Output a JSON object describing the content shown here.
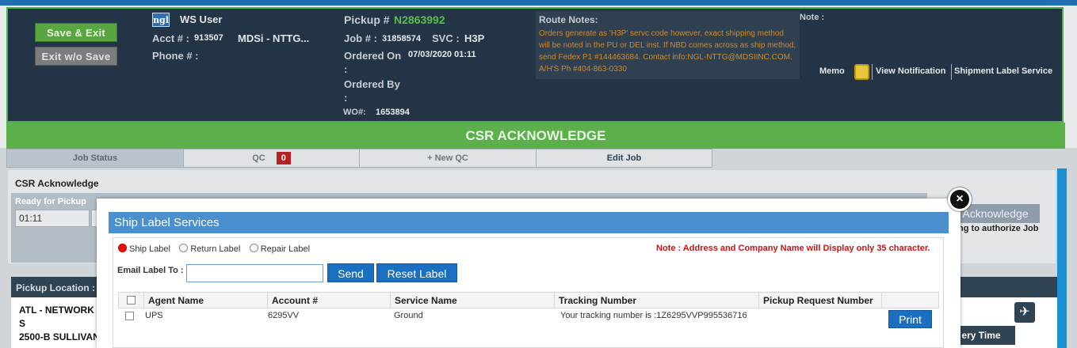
{
  "header": {
    "save_exit": "Save & Exit",
    "exit_no_save": "Exit w/o Save",
    "logo_text": "ngl",
    "user": "WS User",
    "acct_label": "Acct # :",
    "acct_value": "913507",
    "acct_name": "MDSi - NTTG...",
    "phone_label": "Phone # :",
    "pickup_label": "Pickup #",
    "pickup_value": "N2863992",
    "job_label": "Job # :",
    "job_value": "31858574",
    "svc_label": "SVC :",
    "svc_value": "H3P",
    "ordered_on_label": "Ordered On",
    "ordered_on_value": "07/03/2020 01:11",
    "colon": ":",
    "ordered_by_label": "Ordered By",
    "wo_label": "WO#:",
    "wo_value": "1653894",
    "route_notes_title": "Route Notes:",
    "route_notes_text": "Orders generate as 'H3P' servc code however, exact shipping method will be noted in the PU or DEL inst. If NBD comes across as ship method, send Fedex P1 #144463684. Contact info:NGL-NTTG@MDSIINC.COM. A/H'S Ph #404-863-0330",
    "note_label": "Note :",
    "memo": "Memo",
    "view_notification": "View Notification",
    "shipment_label_service": "Shipment Label Service"
  },
  "status_banner": "CSR ACKNOWLEDGE",
  "tabs": {
    "job_status": "Job Status",
    "qc": "QC",
    "qc_count": "0",
    "new_qc": "+ New QC",
    "edit_job": "Edit Job"
  },
  "panel": {
    "title": "CSR Acknowledge",
    "ready_label": "Ready for Pickup",
    "ready_time": "01:11",
    "ack_button": "Acknowledge",
    "ack_note": "ing to authorize Job"
  },
  "pickup": {
    "label": "Pickup Location :",
    "line1": "ATL - NETWORK C",
    "line2": "S",
    "line3": "2500-B SULLIVAN",
    "delivery_label": "ery Time"
  },
  "modal": {
    "title": "Ship Label Services",
    "radio_ship": "Ship Label",
    "radio_return": "Return Label",
    "radio_repair": "Repair Label",
    "note": "Note : Address and Company Name will Display only 35 character.",
    "email_label": "Email Label To :",
    "email_value": "",
    "send": "Send",
    "reset": "Reset Label",
    "columns": [
      "Agent Name",
      "Account #",
      "Service Name",
      "Tracking Number",
      "Pickup Request Number"
    ],
    "row": {
      "agent": "UPS",
      "account": "6295VV",
      "service": "Ground",
      "tracking": "Your tracking number is :1Z6295VVP995536716",
      "pickup_request": "",
      "print": "Print"
    }
  },
  "colors": {
    "header_bg": "#223445",
    "accent_green": "#5bb04c",
    "modal_blue": "#4a8fce",
    "button_blue": "#1a6fc0",
    "note_red": "#c81414",
    "route_orange": "#d08a2c"
  },
  "icons": [
    "logo-icon",
    "memo-icon",
    "plane-icon",
    "close-icon",
    "checkbox-icon",
    "radio-icon"
  ]
}
